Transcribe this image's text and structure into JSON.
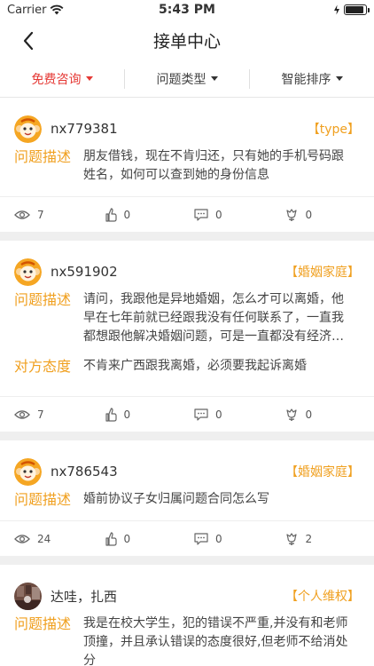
{
  "status_bar": {
    "carrier": "Carrier",
    "time": "5:43 PM",
    "battery_level": 0.9
  },
  "nav": {
    "title": "接单中心"
  },
  "filters": [
    {
      "label": "免费咨询",
      "active": true
    },
    {
      "label": "问题类型",
      "active": false
    },
    {
      "label": "智能排序",
      "active": false
    }
  ],
  "labels": {
    "problem": "问题描述",
    "attitude": "对方态度"
  },
  "cards": [
    {
      "username": "nx779381",
      "tag": "【type】",
      "description": "朋友借钱，现在不肯归还，只有她的手机号码跟姓名，如何可以查到她的身份信息",
      "stats": {
        "views": "7",
        "likes": "0",
        "comments": "0",
        "flowers": "0"
      }
    },
    {
      "username": "nx591902",
      "tag": "【婚姻家庭】",
      "description": "请问，我跟他是异地婚姻，怎么才可以离婚，他早在七年前就已经跟我没有任何联系了，一直我都想跟他解决婚姻问题，可是一直都没有经济…",
      "attitude": "不肯来广西跟我离婚，必须要我起诉离婚",
      "stats": {
        "views": "7",
        "likes": "0",
        "comments": "0",
        "flowers": "0"
      }
    },
    {
      "username": "nx786543",
      "tag": "【婚姻家庭】",
      "description": "婚前协议子女归属问题合同怎么写",
      "stats": {
        "views": "24",
        "likes": "0",
        "comments": "0",
        "flowers": "2"
      }
    },
    {
      "username": "达哇，扎西",
      "tag": "【个人维权】",
      "description": "我是在校大学生，犯的错误不严重,并没有和老师顶撞，并且承认错误的态度很好,但老师不给消处分"
    }
  ]
}
